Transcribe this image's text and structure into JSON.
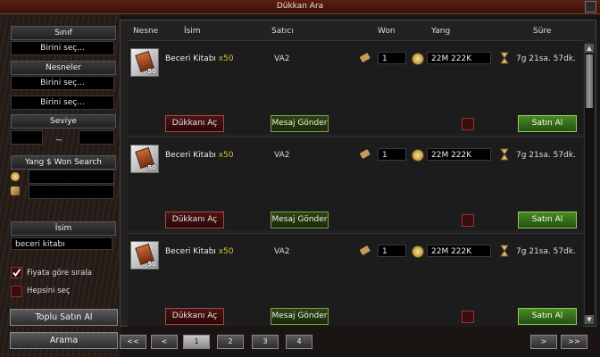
{
  "window": {
    "title": "Dükkan Ara"
  },
  "sidebar": {
    "class_label": "Sınıf",
    "class_value": "Birini seç...",
    "items_label": "Nesneler",
    "items_value1": "Birini seç...",
    "items_value2": "Birini seç...",
    "level_label": "Seviye",
    "level_separator": "~",
    "won_search_label": "Yang $ Won Search",
    "name_label": "İsim",
    "name_value": "beceri kitabı",
    "sort_by_price": "Fiyata göre sırala",
    "sort_by_price_checked": true,
    "select_all": "Hepsini seç",
    "select_all_checked": false,
    "bulk_buy": "Toplu Satın Al",
    "search": "Arama"
  },
  "table": {
    "headers": {
      "item": "Nesne",
      "name": "İsim",
      "seller": "Satıcı",
      "won": "Won",
      "yang": "Yang",
      "time": "Süre"
    },
    "rows": [
      {
        "name": "Beceri Kitabı",
        "qty": "x50",
        "count": "50",
        "seller": "VA2",
        "won": "1",
        "yang": "22M 222K",
        "time": "7g 21sa. 57dk.",
        "open_shop": "Dükkanı Aç",
        "send_message": "Mesaj Gönder",
        "buy": "Satın Al"
      },
      {
        "name": "Beceri Kitabı",
        "qty": "x50",
        "count": "50",
        "seller": "VA2",
        "won": "1",
        "yang": "22M 222K",
        "time": "7g 21sa. 57dk.",
        "open_shop": "Dükkanı Aç",
        "send_message": "Mesaj Gönder",
        "buy": "Satın Al"
      },
      {
        "name": "Beceri Kitabı",
        "qty": "x50",
        "count": "50",
        "seller": "VA2",
        "won": "1",
        "yang": "22M 222K",
        "time": "7g 21sa. 57dk.",
        "open_shop": "Dükkanı Aç",
        "send_message": "Mesaj Gönder",
        "buy": "Satın Al"
      }
    ]
  },
  "pagination": {
    "first": "<<",
    "prev": "<",
    "pages": [
      "1",
      "2",
      "3",
      "4"
    ],
    "current": "1",
    "next": ">",
    "last": ">>"
  }
}
